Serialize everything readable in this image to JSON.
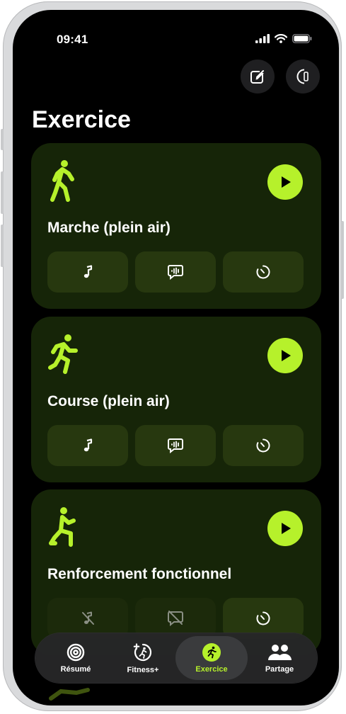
{
  "status": {
    "time": "09:41"
  },
  "header": {
    "title": "Exercice"
  },
  "workouts": [
    {
      "name": "Marche (plein air)"
    },
    {
      "name": "Course (plein air)"
    },
    {
      "name": "Renforcement fonctionnel"
    }
  ],
  "tabs": [
    {
      "label": "Résumé",
      "icon": "rings-icon"
    },
    {
      "label": "Fitness+",
      "icon": "fitness-plus-icon"
    },
    {
      "label": "Exercice",
      "icon": "runner-icon",
      "active": true
    },
    {
      "label": "Partage",
      "icon": "people-icon"
    }
  ],
  "colors": {
    "accent": "#b6f12b",
    "card": "#162508",
    "option": "#27380f"
  }
}
